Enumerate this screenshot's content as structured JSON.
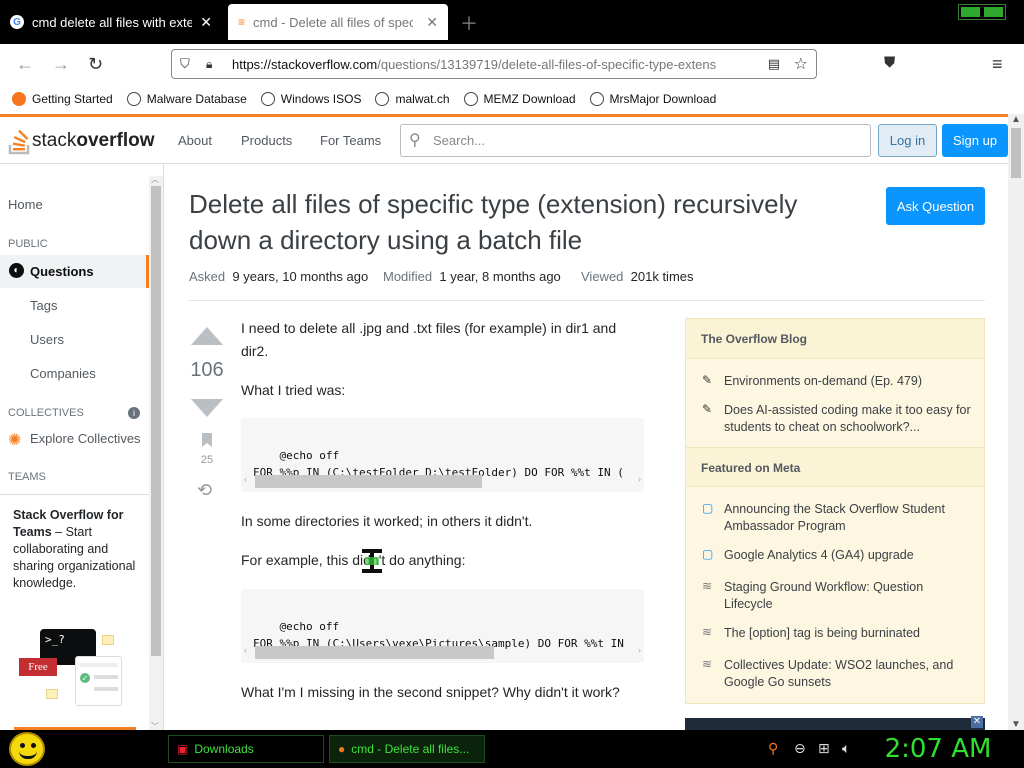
{
  "browser": {
    "tabs": [
      {
        "title": "cmd delete all files with extensi",
        "active": false
      },
      {
        "title": "cmd - Delete all files of specific",
        "active": true
      }
    ],
    "url_host": "https://stackoverflow.com",
    "url_path": "/questions/13139719/delete-all-files-of-specific-type-extens",
    "bookmarks": [
      "Getting Started",
      "Malware Database",
      "Windows ISOS",
      "malwat.ch",
      "MEMZ Download",
      "MrsMajor Download"
    ]
  },
  "header": {
    "logo_pre": "stack",
    "logo_bold": "overflow",
    "links": [
      "About",
      "Products",
      "For Teams"
    ],
    "search_placeholder": "Search...",
    "login": "Log in",
    "signup": "Sign up"
  },
  "leftnav": {
    "home": "Home",
    "public": "PUBLIC",
    "questions": "Questions",
    "tags": "Tags",
    "users": "Users",
    "companies": "Companies",
    "collectives": "COLLECTIVES",
    "explore": "Explore Collectives",
    "teams": "TEAMS",
    "teams_bold": "Stack Overflow for Teams",
    "teams_text": " – Start collaborating and sharing organizational knowledge.",
    "free": "Free"
  },
  "question": {
    "title": "Delete all files of specific type (extension) recursively down a directory using a batch file",
    "ask": "Ask Question",
    "asked_label": "Asked",
    "asked_value": "9 years, 10 months ago",
    "modified_label": "Modified",
    "modified_value": "1 year, 8 months ago",
    "viewed_label": "Viewed",
    "viewed_value": "201k times",
    "votes": "106",
    "bookmarks": "25",
    "p1": "I need to delete all .jpg and .txt files (for example) in dir1 and dir2.",
    "p2": "What I tried was:",
    "code1": "@echo off\nFOR %%p IN (C:\\testFolder D:\\testFolder) DO FOR %%t IN (",
    "p3": "In some directories it worked; in others it didn't.",
    "p4": "For example, this didn't do anything:",
    "code2": "@echo off\nFOR %%p IN (C:\\Users\\vexe\\Pictures\\sample) DO FOR %%t IN",
    "p5": "What I'm I missing in the second snippet? Why didn't it work?"
  },
  "sidebar": {
    "blog_title": "The Overflow Blog",
    "blog_items": [
      "Environments on-demand (Ep. 479)",
      "Does AI-assisted coding make it too easy for students to cheat on schoolwork?..."
    ],
    "meta_title": "Featured on Meta",
    "meta_items": [
      "Announcing the Stack Overflow Student Ambassador Program",
      "Google Analytics 4 (GA4) upgrade",
      "Staging Ground Workflow: Question Lifecycle",
      "The [option] tag is being burninated",
      "Collectives Update: WSO2 launches, and Google Go sunsets"
    ]
  },
  "taskbar": {
    "items": [
      "Downloads",
      "cmd - Delete all files..."
    ],
    "clock": "2:07 AM"
  },
  "colors": {
    "accent": "#f48024",
    "primary": "#0a95ff",
    "taskbar_green": "#3fe13f"
  }
}
